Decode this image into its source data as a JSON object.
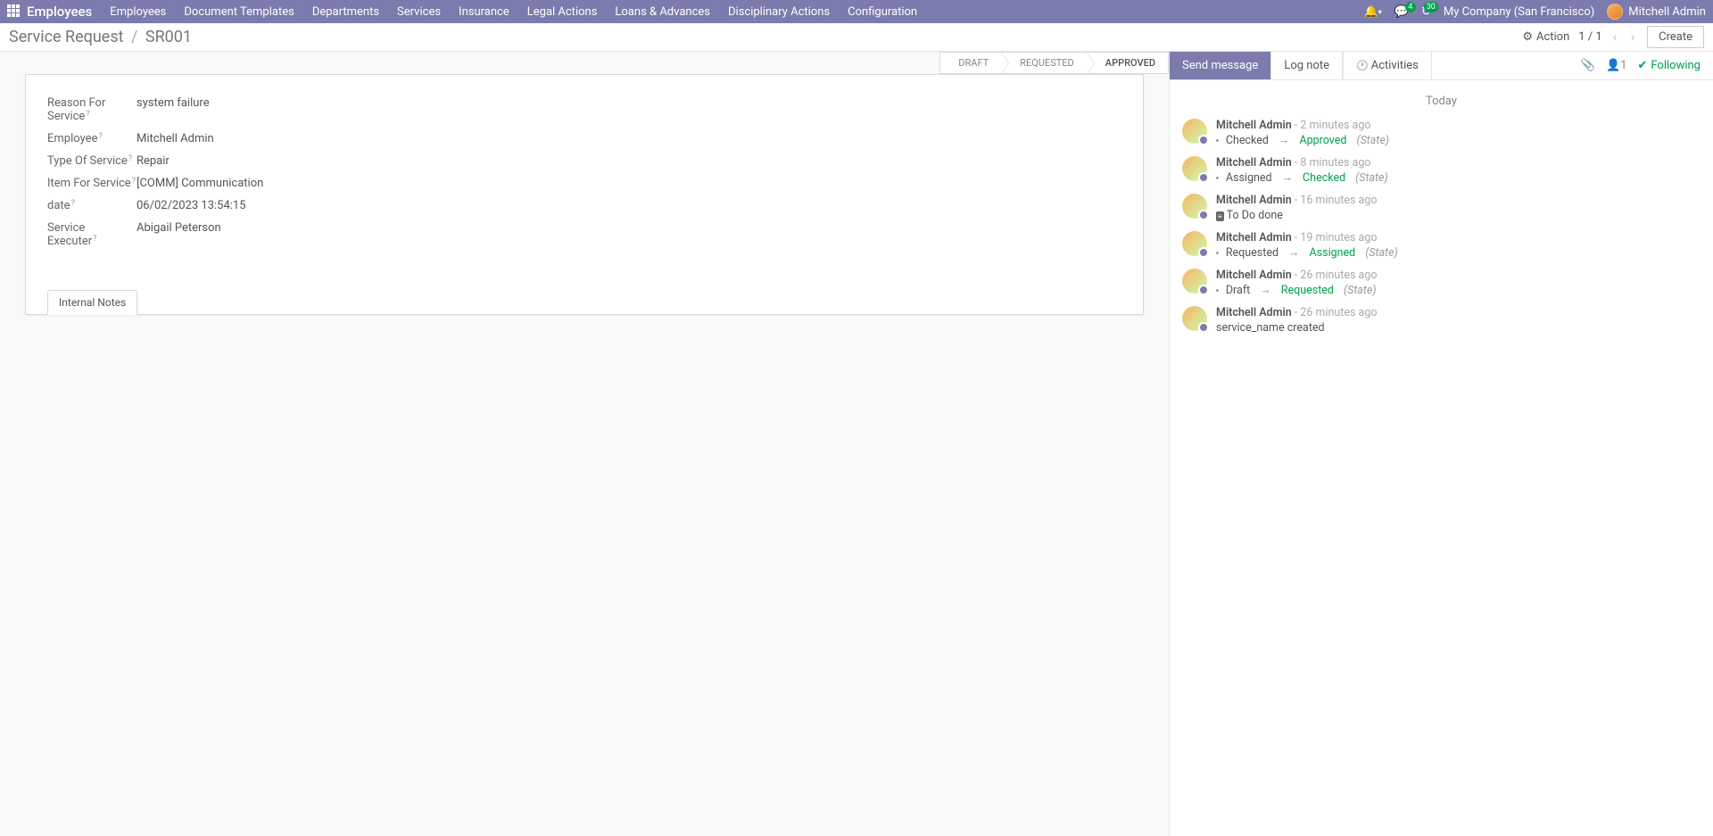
{
  "navbar": {
    "brand": "Employees",
    "items": [
      "Employees",
      "Document Templates",
      "Departments",
      "Services",
      "Insurance",
      "Legal Actions",
      "Loans & Advances",
      "Disciplinary Actions",
      "Configuration"
    ],
    "messages_badge": "4",
    "timer_badge": "30",
    "company": "My Company (San Francisco)",
    "user": "Mitchell Admin"
  },
  "control": {
    "breadcrumb_root": "Service Request",
    "breadcrumb_current": "SR001",
    "action_label": "Action",
    "pager": "1 / 1",
    "create_label": "Create"
  },
  "status": {
    "steps": [
      "DRAFT",
      "REQUESTED",
      "APPROVED"
    ]
  },
  "form": {
    "fields": [
      {
        "label": "Reason For Service",
        "value": "system failure"
      },
      {
        "label": "Employee",
        "value": "Mitchell Admin"
      },
      {
        "label": "Type Of Service",
        "value": "Repair"
      },
      {
        "label": "Item For Service",
        "value": "[COMM] Communication"
      },
      {
        "label": "date",
        "value": "06/02/2023 13:54:15"
      },
      {
        "label": "Service Executer",
        "value": "Abigail Peterson"
      }
    ],
    "tab_label": "Internal Notes"
  },
  "chatter": {
    "send": "Send message",
    "log": "Log note",
    "activities": "Activities",
    "follower_count": "1",
    "following": "Following",
    "today": "Today",
    "messages": [
      {
        "author": "Mitchell Admin",
        "time": "2 minutes ago",
        "type": "change",
        "old": "Checked",
        "new": "Approved",
        "state_label": "(State)"
      },
      {
        "author": "Mitchell Admin",
        "time": "8 minutes ago",
        "type": "change",
        "old": "Assigned",
        "new": "Checked",
        "state_label": "(State)"
      },
      {
        "author": "Mitchell Admin",
        "time": "16 minutes ago",
        "type": "todo",
        "text": "To Do done"
      },
      {
        "author": "Mitchell Admin",
        "time": "19 minutes ago",
        "type": "change",
        "old": "Requested",
        "new": "Assigned",
        "state_label": "(State)"
      },
      {
        "author": "Mitchell Admin",
        "time": "26 minutes ago",
        "type": "change",
        "old": "Draft",
        "new": "Requested",
        "state_label": "(State)"
      },
      {
        "author": "Mitchell Admin",
        "time": "26 minutes ago",
        "type": "text",
        "text": "service_name created"
      }
    ]
  }
}
